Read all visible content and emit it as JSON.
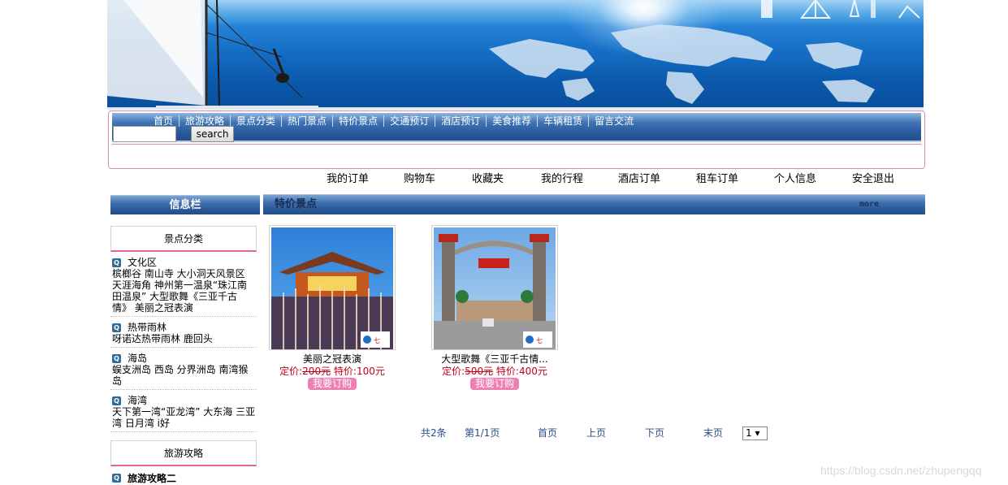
{
  "nav": {
    "items": [
      "首页",
      "旅游攻略",
      "景点分类",
      "热门景点",
      "特价景点",
      "交通预订",
      "酒店预订",
      "美食推荐",
      "车辆租赁",
      "留言交流"
    ],
    "search_placeholder": "",
    "search_button": "search"
  },
  "user_links": [
    "我的订单",
    "购物车",
    "收藏夹",
    "我的行程",
    "酒店订单",
    "租车订单",
    "个人信息",
    "安全退出"
  ],
  "sidebar": {
    "header": "信息栏",
    "box1_title": "景点分类",
    "categories": [
      {
        "name": "文化区",
        "items": "槟榔谷  南山寺  大小洞天风景区  天涯海角  神州第一温泉“珠江南田温泉” 大型歌舞《三亚千古情》 美丽之冠表演"
      },
      {
        "name": "热带雨林",
        "items": "呀诺达热带雨林  鹿回头"
      },
      {
        "name": "海岛",
        "items": "蜈支洲岛  西岛  分界洲岛  南湾猴岛"
      },
      {
        "name": "海湾",
        "items": "天下第一湾“亚龙湾”  大东海  三亚湾  日月湾  i好"
      }
    ],
    "box2_title": "旅游攻略",
    "guide_first": "旅游攻略二",
    "icon_name": "q-icon"
  },
  "main": {
    "title": "特价景点",
    "more": "more",
    "products": [
      {
        "name": "美丽之冠表演",
        "price_label": "定价:",
        "price": "200元",
        "special_label": "特价:",
        "special": "100元",
        "order": "我要订购"
      },
      {
        "name": "大型歌舞《三亚千古情...",
        "price_label": "定价:",
        "price": "500元",
        "special_label": "特价:",
        "special": "400元",
        "order": "我要订购"
      }
    ]
  },
  "pager": {
    "total": "共2条",
    "page": "第1/1页",
    "first": "首页",
    "prev": "上页",
    "next": "下页",
    "last": "末页",
    "select": "1 ▾"
  },
  "watermark": "https://blog.csdn.net/zhupengqq"
}
